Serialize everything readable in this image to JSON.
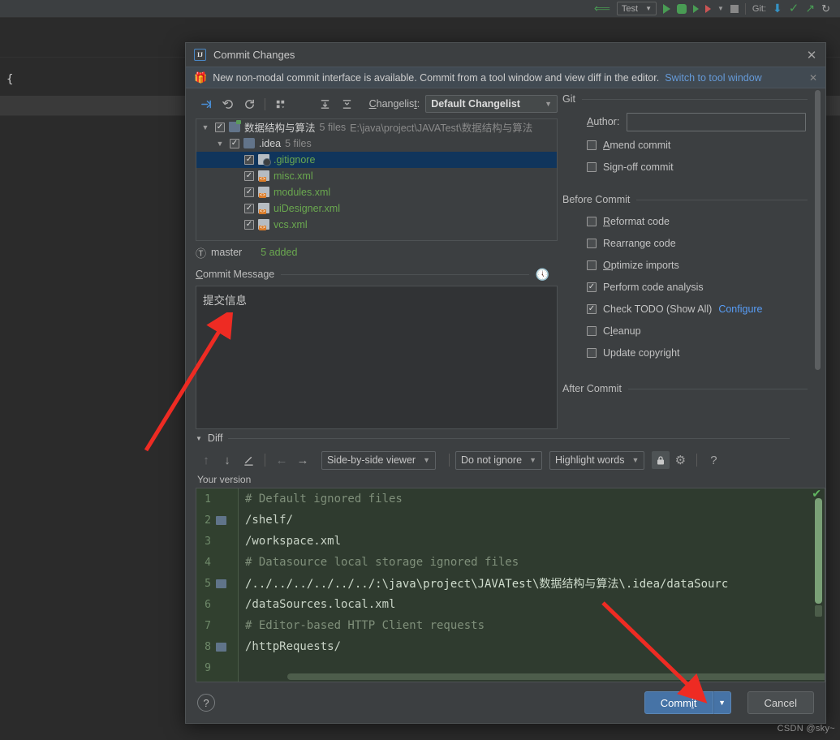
{
  "ide": {
    "toolbar": {
      "run_config": "Test",
      "git_label": "Git:",
      "icons": [
        "back-arrow-icon",
        "run-icon",
        "debug-icon",
        "run-coverage-icon",
        "profile-icon",
        "dropdown-icon",
        "stop-icon",
        "update-project-icon",
        "commit-icon",
        "push-icon",
        "history-icon"
      ]
    },
    "editor_snippet": "{"
  },
  "dialog": {
    "title": "Commit Changes",
    "app_icon": "intellij-idea-icon",
    "close_icon": "close-icon",
    "notification": {
      "icon": "gift-icon",
      "text": "New non-modal commit interface is available. Commit from a tool window and view diff in the editor.",
      "link": "Switch to tool window",
      "close_icon": "close-icon"
    },
    "changes_toolbar": {
      "icons": [
        "show-diff-icon",
        "revert-icon",
        "refresh-icon",
        "group-by-icon",
        "expand-all-icon",
        "collapse-all-icon"
      ],
      "changelist_label": "Changelist:",
      "changelist_value": "Default Changelist"
    },
    "tree": [
      {
        "indent": 0,
        "expanded": true,
        "checked": true,
        "icon": "folder-vcs-icon",
        "name": "数据结构与算法",
        "meta": "5 files",
        "path": "E:\\java\\project\\JAVATest\\数据结构与算法",
        "selected": false,
        "name_color": "plain"
      },
      {
        "indent": 1,
        "expanded": true,
        "checked": true,
        "icon": "folder-icon",
        "name": ".idea",
        "meta": "5 files",
        "path": "",
        "selected": false,
        "name_color": "plain"
      },
      {
        "indent": 2,
        "expanded": null,
        "checked": true,
        "icon": "gitignore-file-icon",
        "name": ".gitignore",
        "meta": "",
        "path": "",
        "selected": true,
        "name_color": "green"
      },
      {
        "indent": 2,
        "expanded": null,
        "checked": true,
        "icon": "xml-file-icon",
        "name": "misc.xml",
        "meta": "",
        "path": "",
        "selected": false,
        "name_color": "green"
      },
      {
        "indent": 2,
        "expanded": null,
        "checked": true,
        "icon": "xml-file-icon",
        "name": "modules.xml",
        "meta": "",
        "path": "",
        "selected": false,
        "name_color": "green"
      },
      {
        "indent": 2,
        "expanded": null,
        "checked": true,
        "icon": "xml-file-icon",
        "name": "uiDesigner.xml",
        "meta": "",
        "path": "",
        "selected": false,
        "name_color": "green"
      },
      {
        "indent": 2,
        "expanded": null,
        "checked": true,
        "icon": "xml-file-icon",
        "name": "vcs.xml",
        "meta": "",
        "path": "",
        "selected": false,
        "name_color": "green"
      }
    ],
    "branch": {
      "icon": "branch-icon",
      "name": "master",
      "added": "5 added"
    },
    "commit_message": {
      "label": "Commit Message",
      "value": "提交信息",
      "history_icon": "history-clock-icon"
    },
    "git_section": {
      "title": "Git",
      "author_label": "Author:",
      "author_value": "",
      "options": [
        {
          "label": "Amend commit",
          "checked": false
        },
        {
          "label": "Sign-off commit",
          "checked": false
        }
      ]
    },
    "before_commit": {
      "title": "Before Commit",
      "options": [
        {
          "label": "Reformat code",
          "checked": false,
          "link": ""
        },
        {
          "label": "Rearrange code",
          "checked": false,
          "link": ""
        },
        {
          "label": "Optimize imports",
          "checked": false,
          "link": ""
        },
        {
          "label": "Perform code analysis",
          "checked": true,
          "link": ""
        },
        {
          "label": "Check TODO (Show All)",
          "checked": true,
          "link": "Configure"
        },
        {
          "label": "Cleanup",
          "checked": false,
          "link": ""
        },
        {
          "label": "Update copyright",
          "checked": false,
          "link": ""
        }
      ]
    },
    "after_commit": {
      "title": "After Commit"
    },
    "diff": {
      "title": "Diff",
      "caret_icon": "chevron-down-icon",
      "toolbar": {
        "icons": [
          "previous-difference-icon",
          "next-difference-icon",
          "annotate-icon",
          "accept-left-icon",
          "accept-right-icon",
          "lock-icon",
          "settings-gear-icon",
          "help-icon"
        ],
        "viewer_mode": "Side-by-side viewer",
        "ignore_mode": "Do not ignore",
        "highlight_mode": "Highlight words"
      },
      "version_label": "Your version",
      "ok_icon": "check-icon",
      "lines": [
        {
          "num": "1",
          "fold": false,
          "text": "# Default ignored files",
          "kind": "comment"
        },
        {
          "num": "2",
          "fold": true,
          "text": "/shelf/",
          "kind": "text"
        },
        {
          "num": "3",
          "fold": false,
          "text": "/workspace.xml",
          "kind": "text"
        },
        {
          "num": "4",
          "fold": false,
          "text": "# Datasource local storage ignored files",
          "kind": "comment"
        },
        {
          "num": "5",
          "fold": true,
          "text": "/../../../../../../:\\java\\project\\JAVATest\\数据结构与算法\\.idea/dataSourc",
          "kind": "text"
        },
        {
          "num": "6",
          "fold": false,
          "text": "/dataSources.local.xml",
          "kind": "text"
        },
        {
          "num": "7",
          "fold": false,
          "text": "# Editor-based HTTP Client requests",
          "kind": "comment"
        },
        {
          "num": "8",
          "fold": true,
          "text": "/httpRequests/",
          "kind": "text"
        },
        {
          "num": "9",
          "fold": false,
          "text": "",
          "kind": "text"
        }
      ]
    },
    "footer": {
      "help_label": "?",
      "commit_label": "Commit",
      "commit_split_icon": "chevron-down-icon",
      "cancel_label": "Cancel"
    }
  },
  "watermark": "CSDN @sky~",
  "colors": {
    "accent_blue": "#4673a6",
    "link_blue": "#589df6",
    "added_green": "#6aa84f",
    "dialog_bg": "#3c3f41",
    "selection_blue": "#10355c",
    "diff_bg": "#2f3b2f",
    "annotation_red": "#ee2b23"
  }
}
